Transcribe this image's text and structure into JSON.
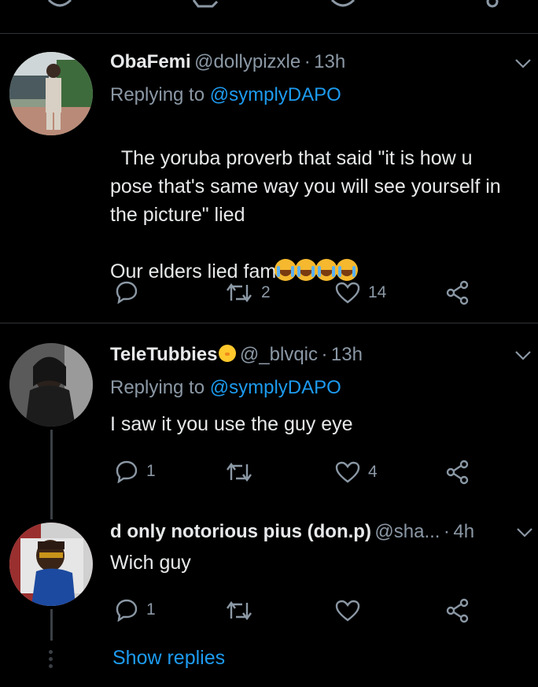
{
  "tweets": [
    {
      "name": "ObaFemi",
      "handle": "@dollypizxle",
      "sep": "·",
      "time": "13h",
      "replying_prefix": "Replying to ",
      "replying_to": "@symplyDAPO",
      "text": "The yoruba proverb that said \"it is how u\npose that's same way you will see yourself in\nthe picture\" lied\n\nOur elders lied fam",
      "emoji_count": 4,
      "reply_count": "",
      "retweet_count": "2",
      "like_count": "14"
    },
    {
      "name": "TeleTubbies",
      "handle": "@_blvqic",
      "sep": "·",
      "time": "13h",
      "replying_prefix": "Replying to ",
      "replying_to": "@symplyDAPO",
      "text": "I saw it you use the guy eye",
      "reply_count": "1",
      "retweet_count": "",
      "like_count": "4"
    },
    {
      "name": "d only notorious pius (don.p)",
      "handle": "@sha...",
      "sep": "·",
      "time": "4h",
      "text": "Wich guy",
      "reply_count": "1",
      "retweet_count": "",
      "like_count": ""
    }
  ],
  "show_replies": "Show replies",
  "colors": {
    "background": "#000000",
    "link": "#1d9bf0",
    "secondary": "#8b98a5",
    "divider": "#2f3336"
  },
  "icons": [
    "reply-icon",
    "retweet-icon",
    "like-icon",
    "share-icon",
    "caret-down-icon"
  ]
}
